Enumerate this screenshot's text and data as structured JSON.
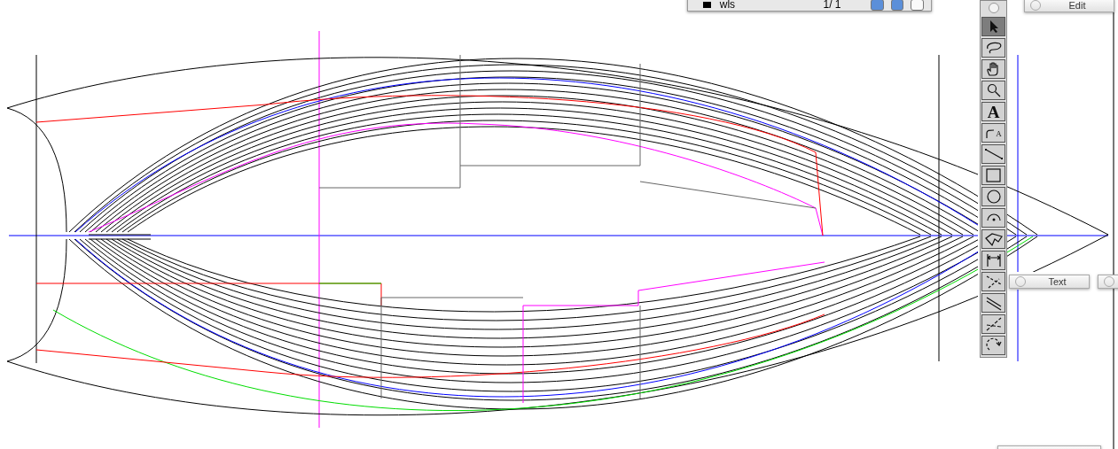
{
  "layer_palette": {
    "layer_name": "wls",
    "page": "1/ 1",
    "toggles": [
      {
        "on": true
      },
      {
        "on": true
      },
      {
        "on": false
      }
    ]
  },
  "tools": [
    {
      "kind": "arrow",
      "selected": true
    },
    {
      "kind": "lasso",
      "selected": false
    },
    {
      "kind": "hand",
      "selected": false
    },
    {
      "kind": "zoom",
      "selected": false
    },
    {
      "kind": "text",
      "label": "A",
      "selected": false
    },
    {
      "kind": "text-path",
      "label": "A",
      "selected": false
    },
    {
      "kind": "line",
      "selected": false
    },
    {
      "kind": "rectangle",
      "selected": false
    },
    {
      "kind": "ellipse",
      "selected": false
    },
    {
      "kind": "arc",
      "selected": false
    },
    {
      "kind": "polygon",
      "selected": false
    },
    {
      "kind": "dimension",
      "selected": false
    },
    {
      "kind": "offset",
      "selected": false
    },
    {
      "kind": "parallel",
      "selected": false
    },
    {
      "kind": "trim",
      "selected": false
    },
    {
      "kind": "rotate",
      "selected": false
    }
  ],
  "palettes": [
    {
      "title": "Edit"
    },
    {
      "title": "Text"
    }
  ]
}
